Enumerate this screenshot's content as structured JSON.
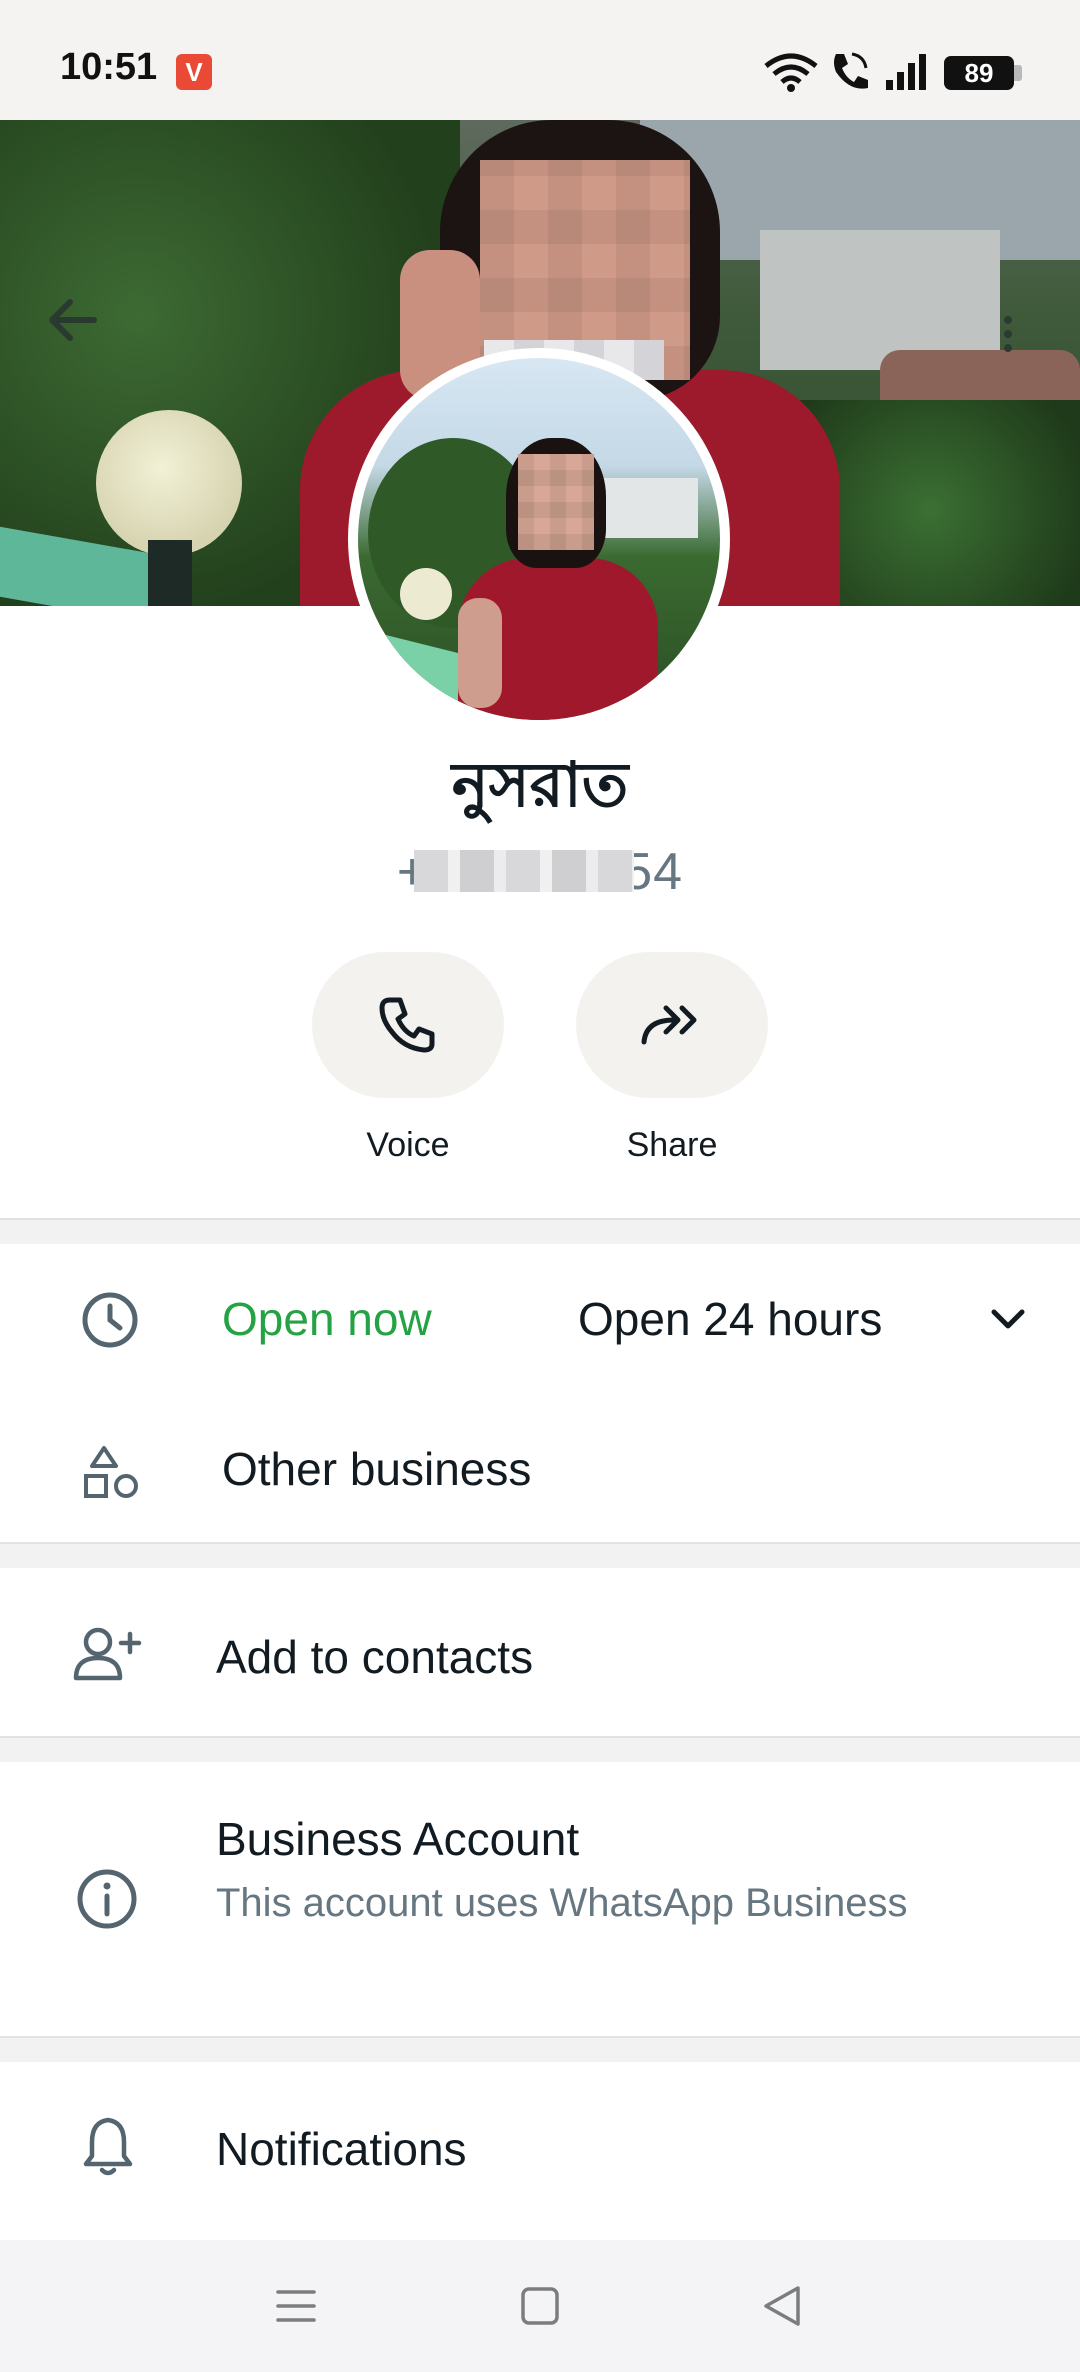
{
  "status_bar": {
    "time": "10:51",
    "app_badge": "V",
    "battery": "89"
  },
  "profile": {
    "name": "নুসরাত",
    "phone": "+880 26854"
  },
  "actions": [
    {
      "label": "Voice",
      "icon": "phone-icon"
    },
    {
      "label": "Share",
      "icon": "share-forward-icon"
    }
  ],
  "hours": {
    "status": "Open now",
    "detail": "Open 24 hours"
  },
  "category": "Other business",
  "add_contact": "Add to contacts",
  "business": {
    "title": "Business Account",
    "subtitle": "This account uses WhatsApp Business"
  },
  "notifications": "Notifications",
  "colors": {
    "accent_green": "#25a244",
    "secondary_text": "#667781"
  }
}
